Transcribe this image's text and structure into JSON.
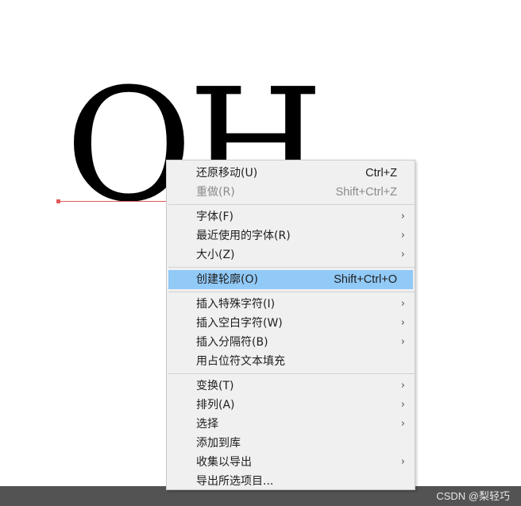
{
  "canvas": {
    "text_content": "OH"
  },
  "context_menu": {
    "groups": [
      {
        "items": [
          {
            "label": "还原移动(U)",
            "shortcut": "Ctrl+Z",
            "disabled": false,
            "submenu": false
          },
          {
            "label": "重做(R)",
            "shortcut": "Shift+Ctrl+Z",
            "disabled": true,
            "submenu": false
          }
        ]
      },
      {
        "items": [
          {
            "label": "字体(F)",
            "shortcut": "",
            "disabled": false,
            "submenu": true
          },
          {
            "label": "最近使用的字体(R)",
            "shortcut": "",
            "disabled": false,
            "submenu": true
          },
          {
            "label": "大小(Z)",
            "shortcut": "",
            "disabled": false,
            "submenu": true
          }
        ]
      },
      {
        "items": [
          {
            "label": "创建轮廓(O)",
            "shortcut": "Shift+Ctrl+O",
            "disabled": false,
            "submenu": false,
            "highlighted": true
          }
        ]
      },
      {
        "items": [
          {
            "label": "插入特殊字符(I)",
            "shortcut": "",
            "disabled": false,
            "submenu": true
          },
          {
            "label": "插入空白字符(W)",
            "shortcut": "",
            "disabled": false,
            "submenu": true
          },
          {
            "label": "插入分隔符(B)",
            "shortcut": "",
            "disabled": false,
            "submenu": true
          },
          {
            "label": "用占位符文本填充",
            "shortcut": "",
            "disabled": false,
            "submenu": false
          }
        ]
      },
      {
        "items": [
          {
            "label": "变换(T)",
            "shortcut": "",
            "disabled": false,
            "submenu": true
          },
          {
            "label": "排列(A)",
            "shortcut": "",
            "disabled": false,
            "submenu": true
          },
          {
            "label": "选择",
            "shortcut": "",
            "disabled": false,
            "submenu": true
          },
          {
            "label": "添加到库",
            "shortcut": "",
            "disabled": false,
            "submenu": false
          },
          {
            "label": "收集以导出",
            "shortcut": "",
            "disabled": false,
            "submenu": true
          },
          {
            "label": "导出所选项目...",
            "shortcut": "",
            "disabled": false,
            "submenu": false
          }
        ]
      }
    ],
    "submenu_arrow": "›",
    "highlight_color": "#91c9f7"
  },
  "watermark": "CSDN @梨轻巧"
}
